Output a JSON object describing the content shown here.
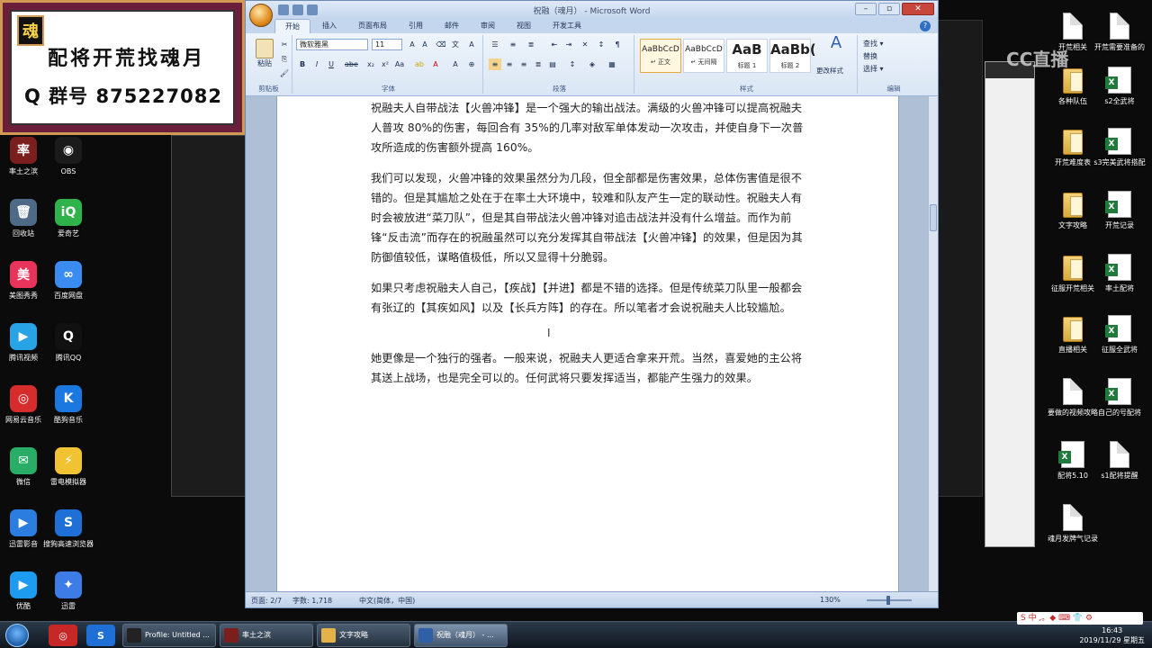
{
  "overlay": {
    "logo_char": "魂",
    "line1": "配将开荒找魂月",
    "line2": "Q 群号 875227082"
  },
  "watermark": "CC直播",
  "desktop_left": [
    {
      "label": "率土之滨",
      "icon": "game-icon",
      "color": "#7a1e1e",
      "glyph": "率"
    },
    {
      "label": "OBS",
      "icon": "obs-icon",
      "color": "#1b1b1b",
      "glyph": "◉"
    },
    {
      "label": "回收站",
      "icon": "recycle-bin-icon",
      "color": "#4e6a86",
      "glyph": "🗑"
    },
    {
      "label": "爱奇艺",
      "icon": "iqiyi-icon",
      "color": "#2db34a",
      "glyph": "iQ"
    },
    {
      "label": "美图秀秀",
      "icon": "meitu-icon",
      "color": "#e8335a",
      "glyph": "美"
    },
    {
      "label": "百度网盘",
      "icon": "baidu-pan-icon",
      "color": "#3b8cf0",
      "glyph": "∞"
    },
    {
      "label": "腾讯视频",
      "icon": "tencent-video-icon",
      "color": "#27a3e6",
      "glyph": "▶"
    },
    {
      "label": "腾讯QQ",
      "icon": "qq-icon",
      "color": "#111111",
      "glyph": "Q"
    },
    {
      "label": "网易云音乐",
      "icon": "netease-music-icon",
      "color": "#d62c2c",
      "glyph": "◎"
    },
    {
      "label": "酷狗音乐",
      "icon": "kugou-icon",
      "color": "#1a78e0",
      "glyph": "K"
    },
    {
      "label": "微信",
      "icon": "wechat-icon",
      "color": "#2aae67",
      "glyph": "✉"
    },
    {
      "label": "雷电模拟器",
      "icon": "ldplayer-icon",
      "color": "#f1c232",
      "glyph": "⚡"
    },
    {
      "label": "迅雷影音",
      "icon": "xunlei-player-icon",
      "color": "#2b7de0",
      "glyph": "▶"
    },
    {
      "label": "搜狗高速浏览器",
      "icon": "sogou-browser-icon",
      "color": "#1e6fd6",
      "glyph": "S"
    },
    {
      "label": "优酷",
      "icon": "youku-icon",
      "color": "#1d9bf0",
      "glyph": "▶"
    },
    {
      "label": "迅雷",
      "icon": "xunlei-icon",
      "color": "#3d7be6",
      "glyph": "✦"
    }
  ],
  "desktop_right": [
    {
      "label": "开荒相关",
      "type": "folder-docs"
    },
    {
      "label": "开荒需要准备的",
      "type": "folder-docs"
    },
    {
      "label": "各种队伍",
      "type": "folder"
    },
    {
      "label": "s2全武将",
      "type": "xls"
    },
    {
      "label": "开荒难度表",
      "type": "folder"
    },
    {
      "label": "s3完美武将搭配",
      "type": "xls"
    },
    {
      "label": "文字攻略",
      "type": "folder"
    },
    {
      "label": "开荒记录",
      "type": "xls"
    },
    {
      "label": "征服开荒相关",
      "type": "folder"
    },
    {
      "label": "率土配将",
      "type": "xls"
    },
    {
      "label": "直播相关",
      "type": "folder"
    },
    {
      "label": "征服全武将",
      "type": "xls"
    },
    {
      "label": "要做的视频攻略",
      "type": "doc"
    },
    {
      "label": "自己的号配将",
      "type": "xls"
    },
    {
      "label": "配将5.10",
      "type": "xls"
    },
    {
      "label": "s1配将提醒",
      "type": "doc"
    },
    {
      "label": "魂月发牌气记录",
      "type": "doc"
    }
  ],
  "word": {
    "title": "祝融（魂月） - Microsoft Word",
    "tabs": [
      "开始",
      "插入",
      "页面布局",
      "引用",
      "邮件",
      "审阅",
      "视图",
      "开发工具"
    ],
    "font_name": "微软雅黑",
    "font_size": "11",
    "groups": [
      "剪贴板",
      "字体",
      "段落",
      "样式",
      "编辑"
    ],
    "paste_label": "粘贴",
    "styles": [
      {
        "preview": "AaBbCcD",
        "name": "↵ 正文",
        "big": false,
        "selected": true
      },
      {
        "preview": "AaBbCcD",
        "name": "↵ 无间隔",
        "big": false,
        "selected": false
      },
      {
        "preview": "AaB",
        "name": "标题 1",
        "big": true,
        "selected": false
      },
      {
        "preview": "AaBb(",
        "name": "标题 2",
        "big": true,
        "selected": false
      }
    ],
    "change_styles": "更改样式",
    "edit_items": [
      "查找 ▾",
      "替换",
      "选择 ▾"
    ],
    "paragraphs": [
      "祝融夫人自带战法【火兽冲锋】是一个强大的输出战法。满级的火兽冲锋可以提高祝融夫人普攻 80%的伤害，每回合有 35%的几率对敌军单体发动一次攻击，并使自身下一次普攻所造成的伤害额外提高 160%。",
      "我们可以发现，火兽冲锋的效果虽然分为几段，但全部都是伤害效果，总体伤害值是很不错的。但是其尴尬之处在于在率土大环境中，较难和队友产生一定的联动性。祝融夫人有时会被放进“菜刀队”，但是其自带战法火兽冲锋对追击战法并没有什么增益。而作为前锋“反击流”而存在的祝融虽然可以充分发挥其自带战法【火兽冲锋】的效果，但是因为其防御值较低，谋略值极低，所以又显得十分脆弱。",
      "如果只考虑祝融夫人自己，【疾战】【并进】都是不错的选择。但是传统菜刀队里一般都会有张辽的【其疾如风】以及【长兵方阵】的存在。所以笔者才会说祝融夫人比较尴尬。",
      "她更像是一个独行的强者。一般来说，祝融夫人更适合拿来开荒。当然，喜爱她的主公将其送上战场，也是完全可以的。任何武将只要发挥适当，都能产生强力的效果。"
    ],
    "status": {
      "page": "页面: 2/7",
      "words": "字数: 1,718",
      "lang": "中文(简体，中国)",
      "zoom": "130%"
    }
  },
  "taskbar": {
    "items": [
      {
        "label": "Profile: Untitled ...",
        "icon": "obs-icon",
        "active": false
      },
      {
        "label": "率土之滨",
        "icon": "game-icon",
        "active": false
      },
      {
        "label": "文字攻略",
        "icon": "folder-icon",
        "active": false
      },
      {
        "label": "祝融（魂月） - ...",
        "icon": "word-icon",
        "active": true
      }
    ],
    "time": "16:43",
    "date": "2019/11/29 星期五",
    "ime": "S 中 ,。◆ ⌨ 👕 ⚙"
  }
}
